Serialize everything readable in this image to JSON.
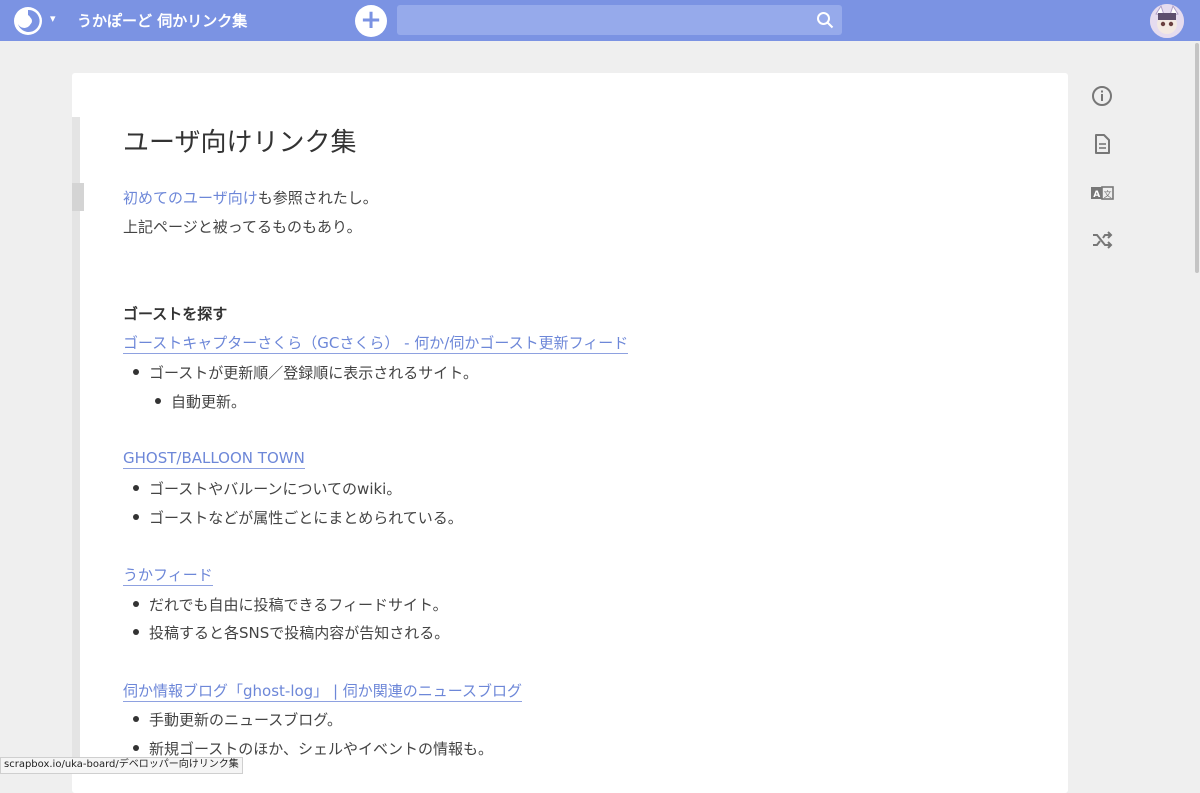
{
  "header": {
    "project_title": "うかぽーど 伺かリンク集",
    "new_page_label": "+",
    "search_placeholder": ""
  },
  "page": {
    "title": "ユーザ向けリンク集",
    "intro_link": "初めてのユーザ向け",
    "intro_rest": "も参照されたし。",
    "intro_line2": "上記ページと被ってるものもあり。",
    "section_heading": "ゴーストを探す",
    "entries": [
      {
        "link": "ゴーストキャプターさくら（GCさくら） - 何か/伺かゴースト更新フィード",
        "bullets": [
          "ゴーストが更新順／登録順に表示されるサイト。"
        ],
        "sub_bullets": [
          "自動更新。"
        ]
      },
      {
        "link": "GHOST/BALLOON TOWN",
        "bullets": [
          "ゴーストやバルーンについてのwiki。",
          "ゴーストなどが属性ごとにまとめられている。"
        ]
      },
      {
        "link": "うかフィード",
        "bullets": [
          "だれでも自由に投稿できるフィードサイト。",
          "投稿すると各SNSで投稿内容が告知される。"
        ]
      },
      {
        "link": "伺か情報ブログ「ghost-log」 | 伺か関連のニュースブログ",
        "bullets": [
          "手動更新のニュースブログ。",
          "新規ゴーストのほか、シェルやイベントの情報も。"
        ]
      }
    ]
  },
  "sidebar_icons": [
    "info-icon",
    "document-icon",
    "translate-icon",
    "shuffle-icon"
  ],
  "status_bar": {
    "url": "scrapbox.io/uka-board/デベロッパー向けリンク集"
  },
  "colors": {
    "navbar": "#7b93e3",
    "link": "#6d87d8",
    "background": "#efefef"
  }
}
